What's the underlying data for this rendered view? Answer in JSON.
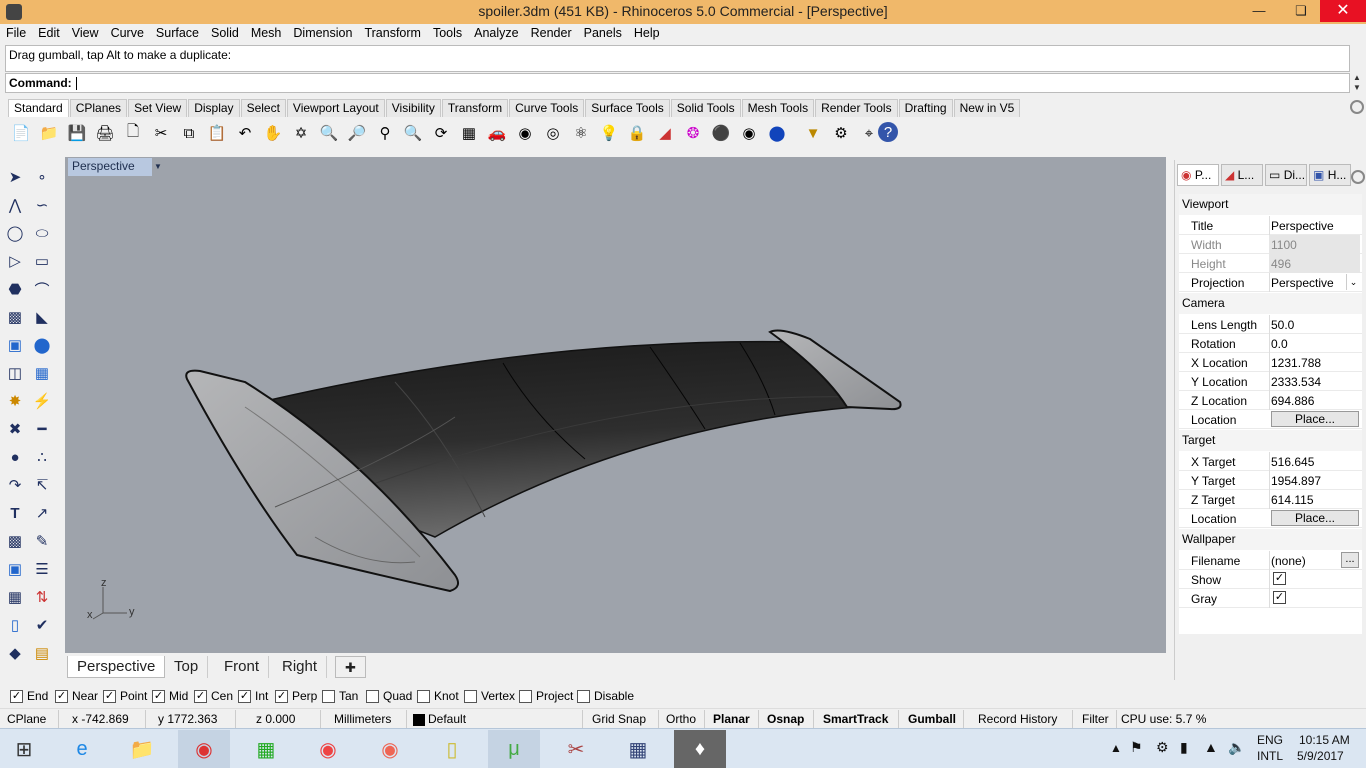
{
  "window": {
    "title": "spoiler.3dm (451 KB) - Rhinoceros 5.0 Commercial - [Perspective]"
  },
  "menu": [
    "File",
    "Edit",
    "View",
    "Curve",
    "Surface",
    "Solid",
    "Mesh",
    "Dimension",
    "Transform",
    "Tools",
    "Analyze",
    "Render",
    "Panels",
    "Help"
  ],
  "command": {
    "history": "Drag gumball, tap Alt to make a duplicate:",
    "prompt": "Command:"
  },
  "toolbar_tabs": [
    "Standard",
    "CPlanes",
    "Set View",
    "Display",
    "Select",
    "Viewport Layout",
    "Visibility",
    "Transform",
    "Curve Tools",
    "Surface Tools",
    "Solid Tools",
    "Mesh Tools",
    "Render Tools",
    "Drafting",
    "New in V5"
  ],
  "toolbar_icons": [
    "new-icon",
    "open-icon",
    "save-icon",
    "print-icon",
    "import-icon",
    "cut-icon",
    "copy-icon",
    "paste-icon",
    "undo-icon",
    "pan-icon",
    "rotate-view-icon",
    "zoom-icon",
    "zoom-window-icon",
    "zoom-extents-icon",
    "zoom-selected-icon",
    "rotate-view-icon",
    "four-viewports-icon",
    "car-icon",
    "named-view-icon",
    "cplane-icon",
    "gumball-icon",
    "light-icon",
    "lock-icon",
    "layers-icon",
    "color-wheel-icon",
    "shaded-icon",
    "rendered-icon",
    "render-sphere-icon",
    "filter-icon",
    "settings-icon",
    "snap-icon",
    "help-icon"
  ],
  "left_tools": [
    "select-icon",
    "point-icon",
    "polyline-icon",
    "curve-icon",
    "circle-icon",
    "ellipse-icon",
    "arc-icon",
    "rectangle-icon",
    "polygon-icon",
    "fillet-curve-icon",
    "surface-corner-icon",
    "extrude-icon",
    "box-icon",
    "sphere-icon",
    "cylinder-icon",
    "mesh-icon",
    "explode-icon",
    "boolean-icon",
    "trim-icon",
    "split-icon",
    "join-icon",
    "group-icon",
    "fillet-icon",
    "chamfer-icon",
    "text-icon",
    "dimension-icon",
    "array-icon",
    "move-icon",
    "rotate-icon",
    "scale-icon",
    "grid-array-icon",
    "mirror-icon",
    "analyze-icon",
    "check-icon",
    "shade-icon",
    "paint-icon"
  ],
  "viewport": {
    "label": "Perspective",
    "axes": {
      "z": "z",
      "x": "x",
      "y": "y"
    }
  },
  "view_tabs": [
    "Perspective",
    "Top",
    "Front",
    "Right"
  ],
  "osnap": [
    {
      "label": "End",
      "checked": true
    },
    {
      "label": "Near",
      "checked": true
    },
    {
      "label": "Point",
      "checked": true
    },
    {
      "label": "Mid",
      "checked": true
    },
    {
      "label": "Cen",
      "checked": true
    },
    {
      "label": "Int",
      "checked": true
    },
    {
      "label": "Perp",
      "checked": true
    },
    {
      "label": "Tan",
      "checked": false
    },
    {
      "label": "Quad",
      "checked": false
    },
    {
      "label": "Knot",
      "checked": false
    },
    {
      "label": "Vertex",
      "checked": false
    },
    {
      "label": "Project",
      "checked": false
    },
    {
      "label": "Disable",
      "checked": false
    }
  ],
  "status": {
    "cplane": "CPlane",
    "x": "x -742.869",
    "y": "y 1772.363",
    "z": "z 0.000",
    "units": "Millimeters",
    "layer": "Default",
    "grid_snap": "Grid Snap",
    "ortho": "Ortho",
    "planar": "Planar",
    "osnap": "Osnap",
    "smarttrack": "SmartTrack",
    "gumball": "Gumball",
    "record_history": "Record History",
    "filter": "Filter",
    "cpu": "CPU use: 5.7 %"
  },
  "panel": {
    "tabs": [
      "P...",
      "L...",
      "Di...",
      "H..."
    ],
    "viewport": {
      "header": "Viewport",
      "title_label": "Title",
      "title_value": "Perspective",
      "width_label": "Width",
      "width_value": "1100",
      "height_label": "Height",
      "height_value": "496",
      "projection_label": "Projection",
      "projection_value": "Perspective"
    },
    "camera": {
      "header": "Camera",
      "lens_label": "Lens Length",
      "lens_value": "50.0",
      "rotation_label": "Rotation",
      "rotation_value": "0.0",
      "xloc_label": "X Location",
      "xloc_value": "1231.788",
      "yloc_label": "Y Location",
      "yloc_value": "2333.534",
      "zloc_label": "Z Location",
      "zloc_value": "694.886",
      "location_label": "Location",
      "place_label": "Place..."
    },
    "target": {
      "header": "Target",
      "x_label": "X Target",
      "x_value": "516.645",
      "y_label": "Y Target",
      "y_value": "1954.897",
      "z_label": "Z Target",
      "z_value": "614.115",
      "location_label": "Location",
      "place_label": "Place..."
    },
    "wallpaper": {
      "header": "Wallpaper",
      "filename_label": "Filename",
      "filename_value": "(none)",
      "browse_label": "...",
      "show_label": "Show",
      "show_checked": true,
      "gray_label": "Gray",
      "gray_checked": true
    }
  },
  "taskbar": {
    "apps": [
      "start-icon",
      "ie-icon",
      "explorer-icon",
      "chrome-icon",
      "store-icon",
      "app-icon",
      "firefox-icon",
      "notes-icon",
      "utorrent-icon",
      "tool-icon",
      "calculator-icon",
      "rhino-icon"
    ],
    "lang1": "ENG",
    "lang2": "INTL",
    "time": "10:15 AM",
    "date": "5/9/2017"
  },
  "colors": {
    "titlebar": "#f0b86a",
    "viewport": "#9ea3ab",
    "close": "#e81123"
  }
}
